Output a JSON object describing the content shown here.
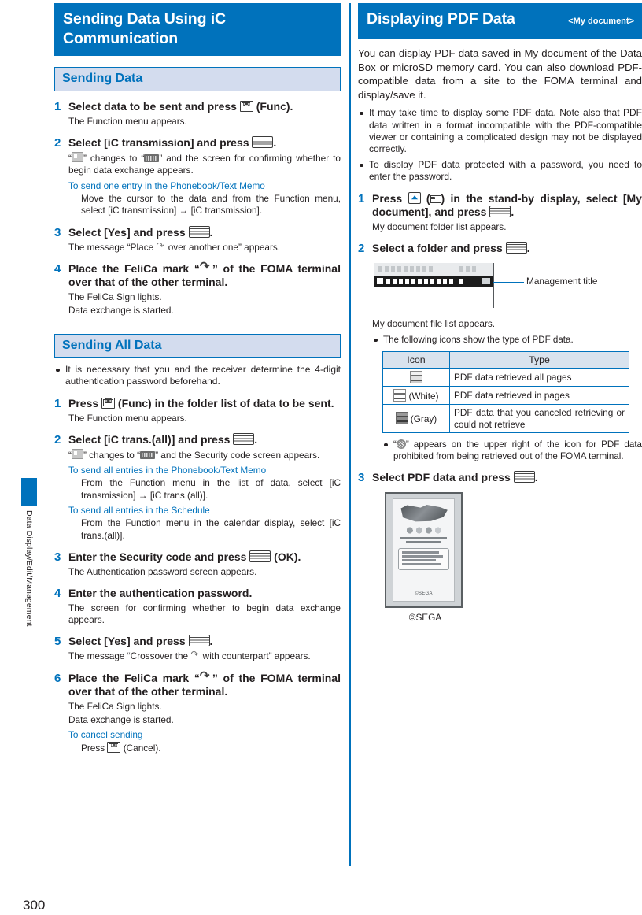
{
  "page": {
    "number": "300",
    "side_tab_label": "Data Display/Edit/Management",
    "accent_color": "#0072bc",
    "section_bg_color": "#d3dcee"
  },
  "left_column": {
    "chapter_title": "Sending Data Using iC Communication",
    "sections": [
      {
        "heading": "Sending Data",
        "steps": [
          {
            "number": "1",
            "title_parts": [
              "Select data to be sent and press ",
              " (Func)."
            ],
            "body": [
              "The Function menu appears."
            ]
          },
          {
            "number": "2",
            "title_parts": [
              "Select [iC transmission] and press ",
              "."
            ],
            "body_lead": "“",
            "body_mid": "” changes to “",
            "body_tail": "” and the screen for confirming whether to begin data exchange appears.",
            "subhead": "To send one entry in the Phonebook/Text Memo",
            "subbody": "Move the cursor to the data and from the Function menu, select [iC transmission] → [iC transmission]."
          },
          {
            "number": "3",
            "title_parts": [
              "Select [Yes] and press ",
              "."
            ],
            "body_lead": "The message “Place ",
            "body_tail": " over another one” appears."
          },
          {
            "number": "4",
            "title_lead": "Place the FeliCa mark “",
            "title_tail": "” of the FOMA terminal over that of the other terminal.",
            "body": [
              "The FeliCa Sign lights.",
              "Data exchange is started."
            ]
          }
        ]
      },
      {
        "heading": "Sending All Data",
        "notes": [
          "It is necessary that you and the receiver determine the 4-digit authentication password beforehand."
        ],
        "steps": [
          {
            "number": "1",
            "title_parts": [
              "Press ",
              " (Func) in the folder list of data to be sent."
            ],
            "body": [
              "The Function menu appears."
            ]
          },
          {
            "number": "2",
            "title_parts": [
              "Select [iC trans.(all)] and press ",
              "."
            ],
            "body_lead": "“",
            "body_mid": "” changes to “",
            "body_tail": "” and the Security code screen appears.",
            "subhead": "To send all entries in the Phonebook/Text Memo",
            "subbody": "From the Function menu in the list of data, select [iC transmission] → [iC trans.(all)].",
            "subhead2": "To send all entries in the Schedule",
            "subbody2": "From the Function menu in the calendar display, select [iC trans.(all)]."
          },
          {
            "number": "3",
            "title_parts": [
              "Enter the Security code and press ",
              " (OK)."
            ],
            "body": [
              "The Authentication password screen appears."
            ]
          },
          {
            "number": "4",
            "title_plain": "Enter the authentication password.",
            "body": [
              "The screen for confirming whether to begin data exchange appears."
            ]
          },
          {
            "number": "5",
            "title_parts": [
              "Select [Yes] and press ",
              "."
            ],
            "body_lead": "The message “Crossover the ",
            "body_tail": " with counterpart” appears."
          },
          {
            "number": "6",
            "title_lead": "Place the FeliCa mark “",
            "title_tail": "” of the FOMA terminal over that of the other terminal.",
            "body": [
              "The FeliCa Sign lights.",
              "Data exchange is started."
            ],
            "subhead": "To cancel sending",
            "subbody_lead": "Press ",
            "subbody_tail": " (Cancel)."
          }
        ]
      }
    ]
  },
  "right_column": {
    "chapter_title": "Displaying PDF Data",
    "chapter_subtitle": "<My document>",
    "intro": "You can display PDF data saved in My document of the Data Box or microSD memory card. You can also download PDF-compatible data from a site to the FOMA terminal and display/save it.",
    "notes": [
      "It may take time to display some PDF data. Note also that PDF data written in a format incompatible with the PDF-compatible viewer or containing a complicated design may not be displayed correctly.",
      "To display PDF data protected with a password, you need to enter the password."
    ],
    "steps": [
      {
        "number": "1",
        "title_p1": "Press ",
        "title_p2": " (",
        "title_p3": ") in the stand-by display, select [My document], and press ",
        "title_p4": ".",
        "body": [
          "My document folder list appears."
        ]
      },
      {
        "number": "2",
        "title_parts": [
          "Select a folder and press ",
          "."
        ],
        "callout": "Management title",
        "body": [
          "My document file list appears."
        ],
        "note": "The following icons show the type of PDF data.",
        "table": {
          "headers": [
            "Icon",
            "Type"
          ],
          "rows": [
            {
              "icon_label": "",
              "type": "PDF data retrieved all pages"
            },
            {
              "icon_label": "(White)",
              "type": "PDF data retrieved in pages"
            },
            {
              "icon_label": "(Gray)",
              "type": "PDF data that you canceled retrieving or could not retrieve"
            }
          ]
        },
        "after_note_lead": "“",
        "after_note_tail": "” appears on the upper right of the icon for PDF data prohibited from being retrieved out of the FOMA terminal."
      },
      {
        "number": "3",
        "title_parts": [
          "Select PDF data and press ",
          "."
        ],
        "figure_caption": "©SEGA",
        "figure_inner_credit": "©SEGA"
      }
    ]
  }
}
